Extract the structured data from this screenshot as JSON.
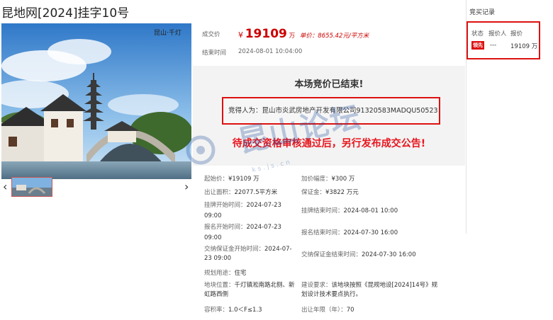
{
  "page": {
    "title": "昆地网[2024]挂字10号"
  },
  "photo": {
    "caption": "昆山·千灯"
  },
  "deal": {
    "price_label": "成交价",
    "yen": "¥",
    "price": "19109",
    "price_unit": "万",
    "unit_price": "单价：8655.42元/平方米",
    "end_label": "结束时间",
    "end_time": "2024-08-01 10:04:00"
  },
  "status": {
    "heading": "本场竞价已结束!",
    "winner_label": "竞得人为：",
    "winner": "昆山市炎武房地产开发有限公司91320583MADQU50523",
    "notice": "待成交资格审核通过后，另行发布成交公告!"
  },
  "details": {
    "start_price_label": "起始价：",
    "start_price": "¥19109 万",
    "increment_label": "加价幅度：",
    "increment": "¥300 万",
    "area_label": "出让面积：",
    "area": "22077.5平方米",
    "deposit_label": "保证金：",
    "deposit": "¥3822 万元",
    "list_start_label": "挂牌开始时间：",
    "list_start": "2024-07-23 09:00",
    "list_end_label": "挂牌结束时间：",
    "list_end": "2024-08-01 10:00",
    "reg_start_label": "报名开始时间：",
    "reg_start": "2024-07-23 09:00",
    "reg_end_label": "报名结束时间：",
    "reg_end": "2024-07-30 16:00",
    "dep_start_label": "交纳保证金开始时间：",
    "dep_start": "2024-07-23 09:00",
    "dep_end_label": "交纳保证金结束时间：",
    "dep_end": "2024-07-30 16:00",
    "use_label": "规划用途：",
    "use": "住宅",
    "location_label": "地块位置：",
    "location": "千灯镇淞南路北侧、新虹路西侧",
    "requirement_label": "建设要求：",
    "requirement": "该地块按照《昆规地设[2024]14号》规划设计技术要点执行。",
    "far_label": "容积率：",
    "far": "1.0＜F≤1.3",
    "years_label": "出让年限（年）：",
    "years": "70"
  },
  "bids": {
    "title": "竞买记录",
    "headers": [
      "状态",
      "报价人",
      "报价"
    ],
    "rows": [
      {
        "status": "领先",
        "bidder": "---",
        "price": "19109 万"
      }
    ]
  },
  "watermark": {
    "text": "昆山论坛",
    "sub": "ks.js.cn"
  },
  "nav": {
    "prev": "‹",
    "next": "›"
  }
}
